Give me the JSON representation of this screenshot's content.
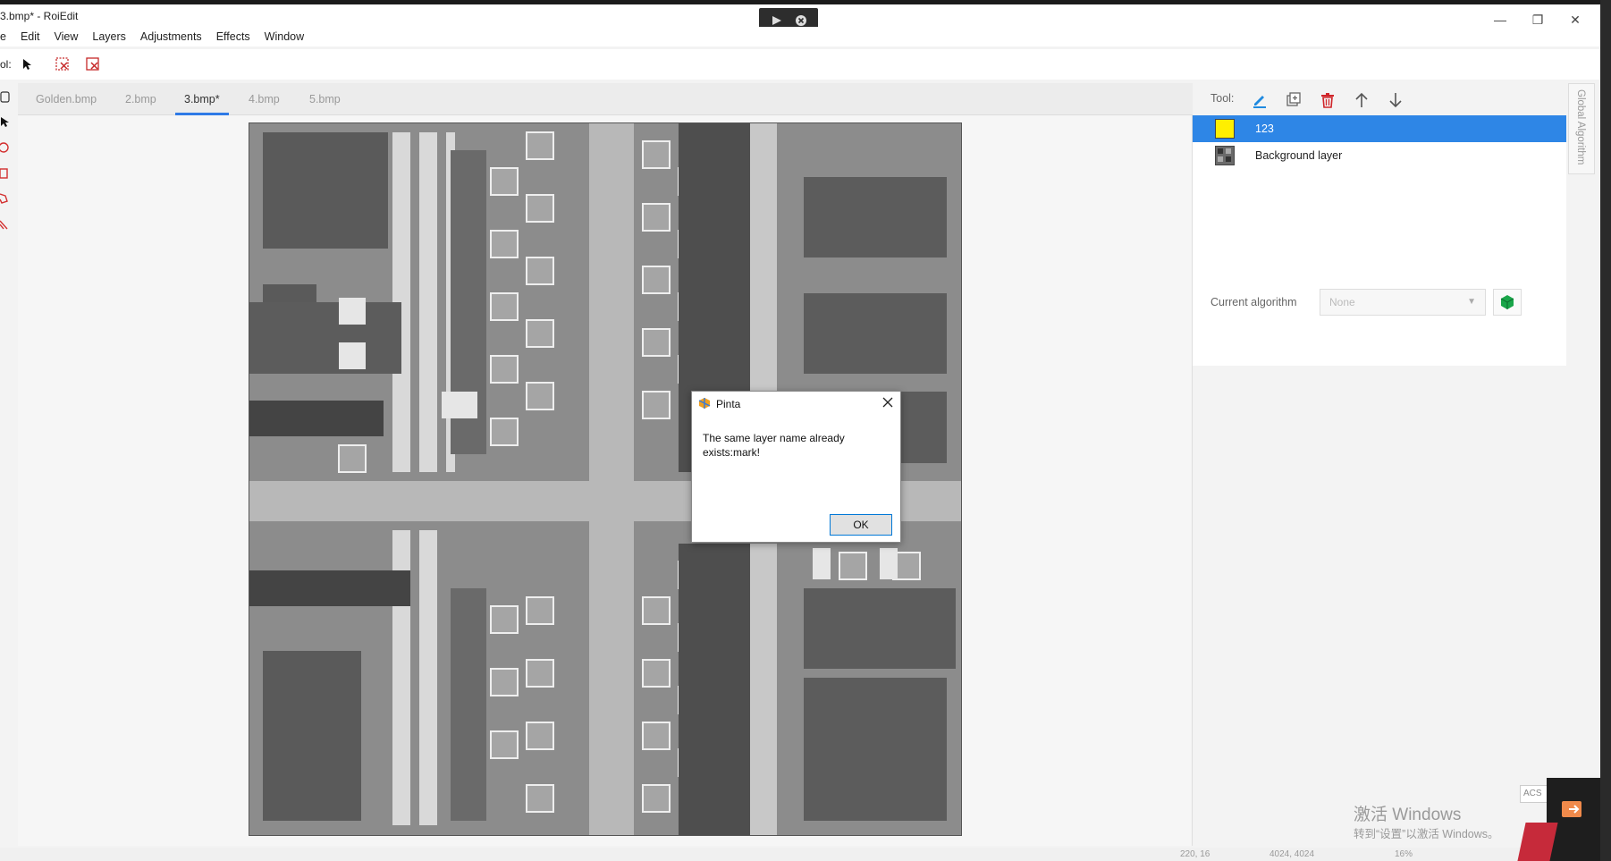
{
  "window": {
    "title": "3.bmp* - RoiEdit",
    "minimize_glyph": "—",
    "restore_glyph": "❐",
    "close_glyph": "✕"
  },
  "menu": [
    "e",
    "Edit",
    "View",
    "Layers",
    "Adjustments",
    "Effects",
    "Window"
  ],
  "toolbar": {
    "label": "ol:"
  },
  "tabs": [
    {
      "label": "Golden.bmp",
      "active": false
    },
    {
      "label": "2.bmp",
      "active": false
    },
    {
      "label": "3.bmp*",
      "active": true
    },
    {
      "label": "4.bmp",
      "active": false
    },
    {
      "label": "5.bmp",
      "active": false
    }
  ],
  "right_panel": {
    "tool_label": "Tool:",
    "layers": [
      {
        "name": "123",
        "selected": true,
        "thumb_color": "#ffef00"
      },
      {
        "name": "Background layer",
        "selected": false,
        "thumb_color": "#555555"
      }
    ],
    "algorithm_label": "Current algorithm",
    "algorithm_value": "None",
    "global_algorithm_tab": "Global Algorithm"
  },
  "dialog": {
    "title": "Pinta",
    "message": "The same layer name already exists:mark!",
    "ok_label": "OK"
  },
  "watermark": {
    "line1": "激活 Windows",
    "line2": "转到“设置”以激活 Windows。"
  },
  "status": {
    "coords": "220, 16",
    "size": "4024, 4024",
    "zoom": "16%"
  },
  "tray": {
    "badge": "ACS"
  },
  "colors": {
    "accent": "#2e86e6",
    "delete_red": "#d0262b",
    "edit_blue": "#1f8ae0",
    "green": "#1aa64a"
  }
}
